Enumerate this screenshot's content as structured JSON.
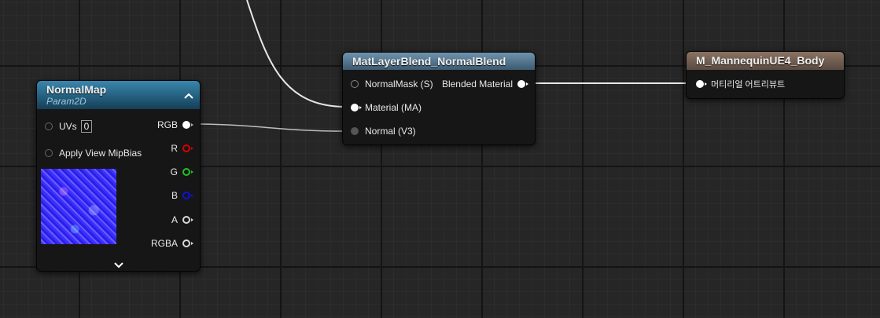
{
  "colors": {
    "param_header": "#2a6a8a",
    "func_header": "#4f6f85",
    "result_header": "#6e5a4d",
    "wire": "#e8e8e8",
    "pin_r": "#d40000",
    "pin_g": "#20c020",
    "pin_b": "#1010dd"
  },
  "normalmap_node": {
    "title": "NormalMap",
    "subtitle": "Param2D",
    "inputs": [
      {
        "label": "UVs",
        "value": "0"
      },
      {
        "label": "Apply View MipBias"
      }
    ],
    "outputs": [
      "RGB",
      "R",
      "G",
      "B",
      "A",
      "RGBA"
    ],
    "collapse_icon": "chevron-up-icon",
    "expand_icon": "chevron-down-icon"
  },
  "blend_node": {
    "title": "MatLayerBlend_NormalBlend",
    "inputs": [
      "NormalMask (S)",
      "Material (MA)",
      "Normal (V3)"
    ],
    "output": "Blended Material"
  },
  "result_node": {
    "title": "M_MannequinUE4_Body",
    "input": "머티리얼 어트리뷰트"
  }
}
